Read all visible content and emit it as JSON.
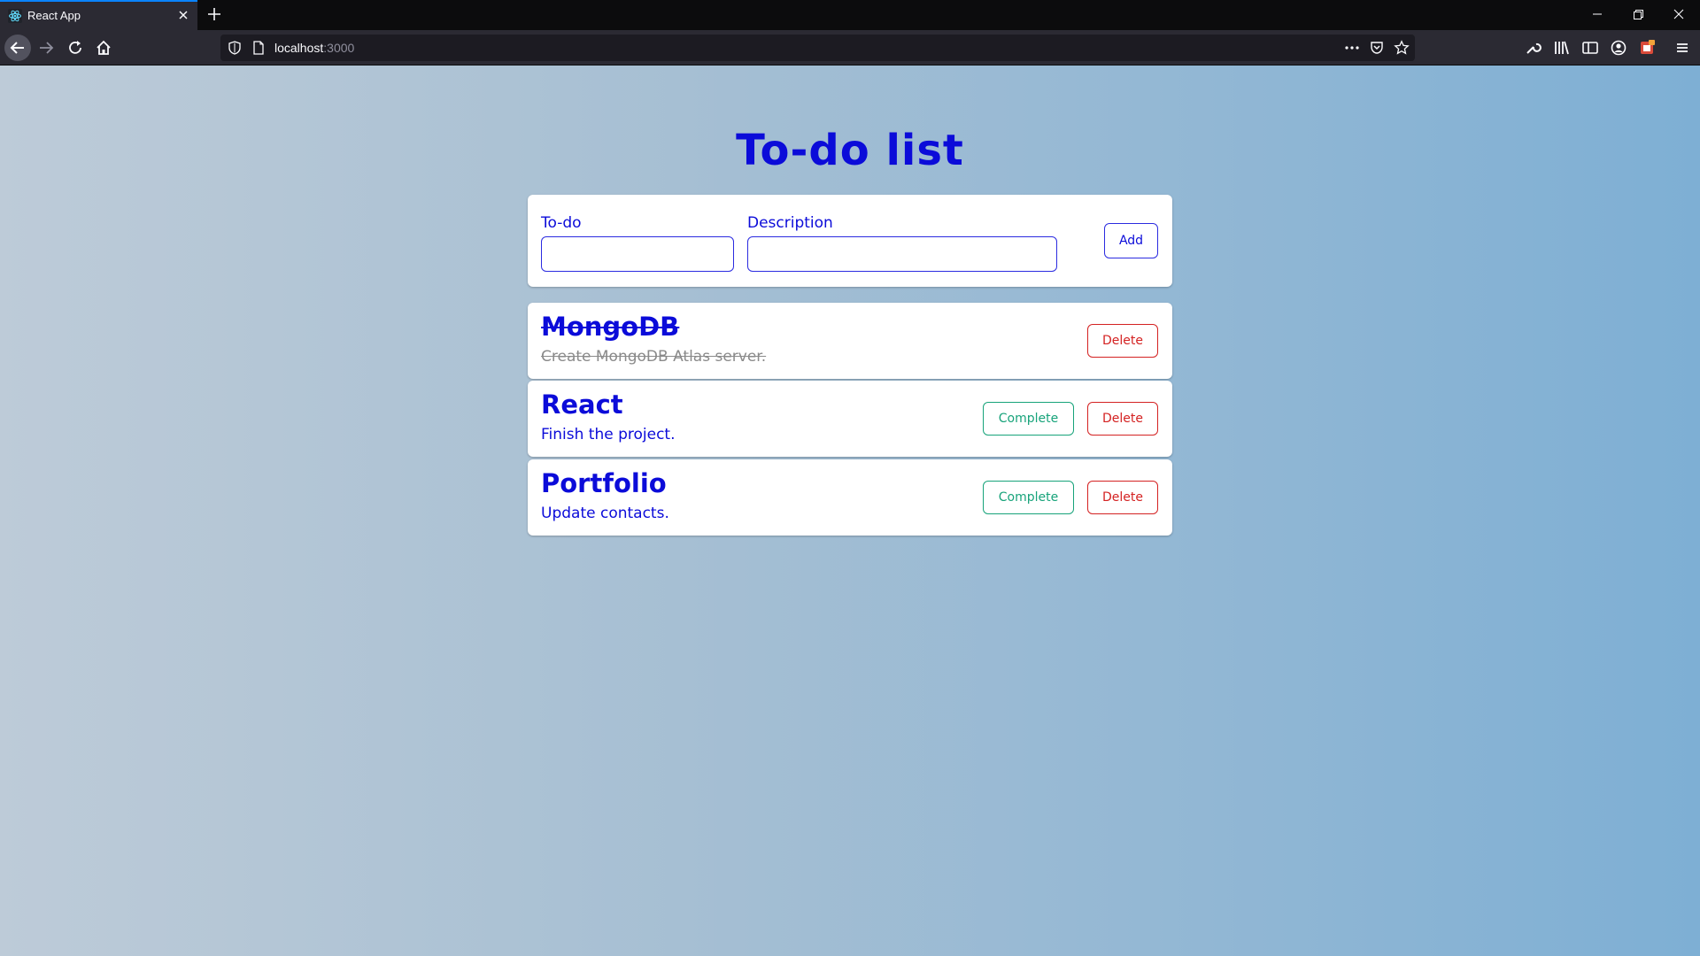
{
  "browser": {
    "tab_title": "React App",
    "url_host": "localhost",
    "url_port": ":3000",
    "theme": {
      "chrome_dark": "#0c0c0d",
      "chrome": "#2b2a33",
      "accent": "#0a84ff"
    }
  },
  "app": {
    "title": "To-do list",
    "form": {
      "todo_label": "To-do",
      "todo_value": "",
      "description_label": "Description",
      "description_value": "",
      "add_label": "Add"
    },
    "todos": [
      {
        "title": "MongoDB",
        "description": "Create MongoDB Atlas server.",
        "completed": true,
        "delete_label": "Delete"
      },
      {
        "title": "React",
        "description": "Finish the project.",
        "completed": false,
        "complete_label": "Complete",
        "delete_label": "Delete"
      },
      {
        "title": "Portfolio",
        "description": "Update contacts.",
        "completed": false,
        "complete_label": "Complete",
        "delete_label": "Delete"
      }
    ],
    "colors": {
      "primary": "#0b0bd9",
      "complete": "#17a37a",
      "delete": "#d42222",
      "done_text": "#8a8a8a"
    }
  }
}
